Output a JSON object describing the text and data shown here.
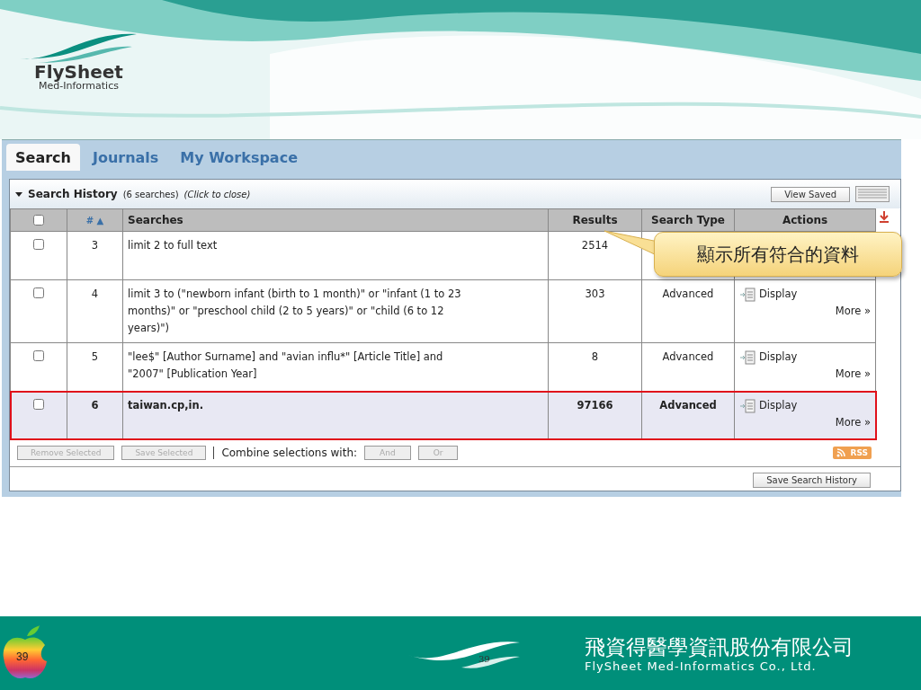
{
  "brand": {
    "name": "FlySheet",
    "tagline": "Med-Informatics"
  },
  "tabs": [
    {
      "label": "Search",
      "selected": true
    },
    {
      "label": "Journals",
      "selected": false
    },
    {
      "label": "My Workspace",
      "selected": false
    }
  ],
  "history": {
    "expanded": true,
    "title": "Search History",
    "count": "(6 searches)",
    "hint": "(Click to close)",
    "view_saved": "View Saved"
  },
  "table": {
    "select_all": false,
    "columns": [
      "# ▲",
      "Searches",
      "Results",
      "Search Type",
      "Actions"
    ],
    "rows": [
      {
        "checked": false,
        "number": "3",
        "query": "limit 2 to full text",
        "results": "2514",
        "highlighted": false
      },
      {
        "checked": false,
        "number": "4",
        "query": "limit 3 to (\"newborn infant (birth to 1 month)\" or \"infant (1 to 23 months)\" or \"preschool child (2 to 5 years)\" or \"child (6 to 12 years)\")",
        "results": "303",
        "type": "Advanced",
        "display": "Display",
        "more": "More »",
        "highlighted": false
      },
      {
        "checked": false,
        "number": "5",
        "query": "\"lee$\" [Author Surname] and \"avian influ*\" [Article Title] and \"2007\" [Publication Year]",
        "results": "8",
        "type": "Advanced",
        "display": "Display",
        "more": "More »",
        "highlighted": false
      },
      {
        "checked": false,
        "number": "6",
        "query": "taiwan.cp,in.",
        "results": "97166",
        "type": "Advanced",
        "display": "Display",
        "more": "More »",
        "highlighted": true
      }
    ]
  },
  "toolbar": {
    "remove": "Remove Selected",
    "save": "Save Selected",
    "combine_label": "Combine selections with:",
    "and": "And",
    "or": "Or",
    "rss": "RSS",
    "save_history": "Save Search History"
  },
  "callout": "顯示所有符合的資料",
  "footer": {
    "slide_number": "39",
    "page_mark": "39",
    "company_zh": "飛資得醫學資訊股份有限公司",
    "company_en": "FlySheet Med-Informatics Co., Ltd."
  }
}
